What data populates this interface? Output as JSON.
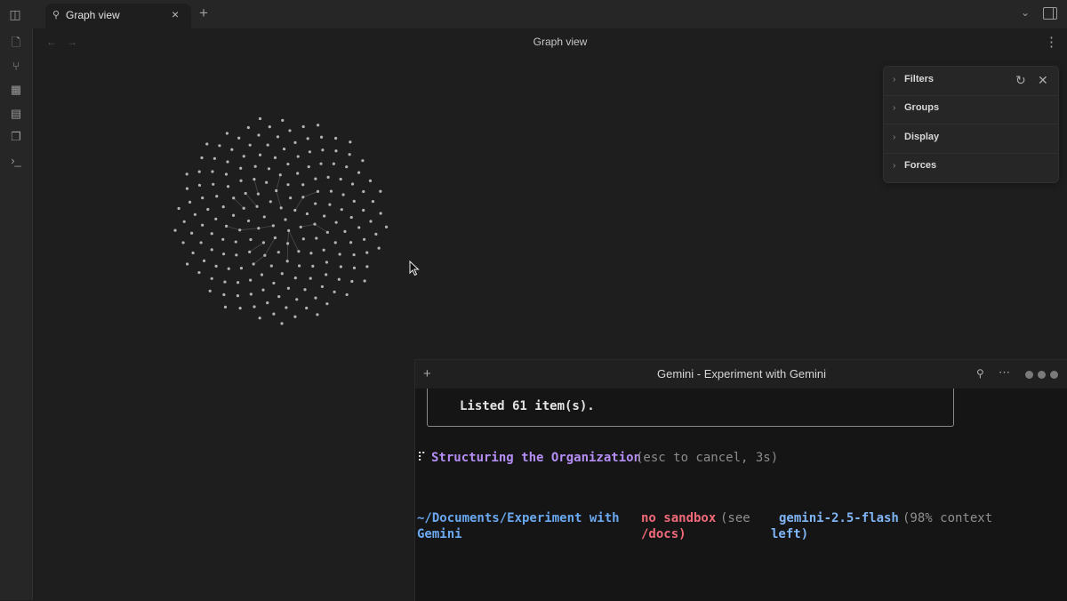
{
  "tab": {
    "title": "Graph view"
  },
  "header": {
    "title": "Graph view"
  },
  "graph_controls": {
    "sections": [
      "Filters",
      "Groups",
      "Display",
      "Forces"
    ]
  },
  "terminal": {
    "title": "Gemini - Experiment with Gemini",
    "tool_result": "Listed 61 item(s).",
    "spinner": "⠏",
    "thinking": "Structuring the Organization",
    "thinking_hint": "(esc to cancel, 3s)",
    "path_line1": "~/Documents/Experiment with",
    "path_line2": "Gemini",
    "sandbox_line1": "no sandbox",
    "sandbox_see": "(see",
    "sandbox_line2": "/docs)",
    "model": "gemini-2.5-flash",
    "context": "(98% context",
    "context_end": "left)"
  },
  "colors": {
    "accent_purple": "#b48ef5",
    "path_blue": "#6aa8f0",
    "sandbox_red": "#f06a7a"
  }
}
